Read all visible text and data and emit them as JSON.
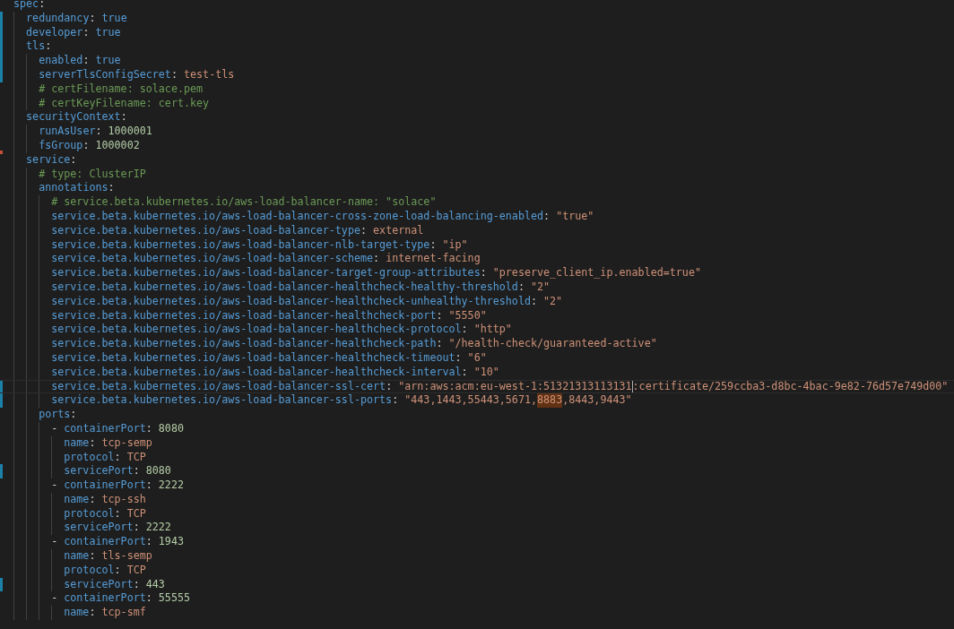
{
  "editor": {
    "lines": [
      {
        "tokens": [
          {
            "kind": "key",
            "text": "spec"
          },
          {
            "kind": "colon",
            "text": ":"
          }
        ],
        "children": [
          {
            "modified": true,
            "tokens": [
              {
                "kind": "key",
                "text": "redundancy"
              },
              {
                "kind": "colon",
                "text": ":"
              },
              {
                "kind": "bool",
                "text": "true"
              }
            ]
          },
          {
            "modified": true,
            "tokens": [
              {
                "kind": "key",
                "text": "developer"
              },
              {
                "kind": "colon",
                "text": ":"
              },
              {
                "kind": "bool",
                "text": "true"
              }
            ]
          },
          {
            "modified": true,
            "tokens": [
              {
                "kind": "key",
                "text": "tls"
              },
              {
                "kind": "colon",
                "text": ":"
              }
            ],
            "children": [
              {
                "modified": true,
                "tokens": [
                  {
                    "kind": "key",
                    "text": "enabled"
                  },
                  {
                    "kind": "colon",
                    "text": ":"
                  },
                  {
                    "kind": "bool",
                    "text": "true"
                  }
                ]
              },
              {
                "modified": true,
                "tokens": [
                  {
                    "kind": "key",
                    "text": "serverTlsConfigSecret"
                  },
                  {
                    "kind": "colon",
                    "text": ":"
                  },
                  {
                    "kind": "string",
                    "text": "test-tls"
                  }
                ]
              },
              {
                "tokens": [
                  {
                    "kind": "comment",
                    "text": "# certFilename: solace.pem"
                  }
                ]
              },
              {
                "tokens": [
                  {
                    "kind": "comment",
                    "text": "# certKeyFilename: cert.key"
                  }
                ]
              }
            ]
          },
          {
            "tokens": [
              {
                "kind": "key",
                "text": "securityContext"
              },
              {
                "kind": "colon",
                "text": ":"
              }
            ],
            "children": [
              {
                "tokens": [
                  {
                    "kind": "key",
                    "text": "runAsUser"
                  },
                  {
                    "kind": "colon",
                    "text": ":"
                  },
                  {
                    "kind": "number",
                    "text": "1000001"
                  }
                ]
              },
              {
                "tokens": [
                  {
                    "kind": "key",
                    "text": "fsGroup"
                  },
                  {
                    "kind": "colon",
                    "text": ":"
                  },
                  {
                    "kind": "number",
                    "text": "1000002"
                  }
                ]
              }
            ]
          },
          {
            "deleted_above": true,
            "tokens": [
              {
                "kind": "key",
                "text": "service"
              },
              {
                "kind": "colon",
                "text": ":"
              }
            ],
            "children": [
              {
                "tokens": [
                  {
                    "kind": "comment",
                    "text": "# type: ClusterIP"
                  }
                ]
              },
              {
                "tokens": [
                  {
                    "kind": "key",
                    "text": "annotations"
                  },
                  {
                    "kind": "colon",
                    "text": ":"
                  }
                ],
                "children": [
                  {
                    "tokens": [
                      {
                        "kind": "comment",
                        "text": "# service.beta.kubernetes.io/aws-load-balancer-name: \"solace\""
                      }
                    ]
                  },
                  {
                    "tokens": [
                      {
                        "kind": "key",
                        "text": "service.beta.kubernetes.io/aws-load-balancer-cross-zone-load-balancing-enabled"
                      },
                      {
                        "kind": "colon",
                        "text": ":"
                      },
                      {
                        "kind": "string",
                        "text": "\"true\""
                      }
                    ]
                  },
                  {
                    "tokens": [
                      {
                        "kind": "key",
                        "text": "service.beta.kubernetes.io/aws-load-balancer-type"
                      },
                      {
                        "kind": "colon",
                        "text": ":"
                      },
                      {
                        "kind": "string",
                        "text": "external"
                      }
                    ]
                  },
                  {
                    "tokens": [
                      {
                        "kind": "key",
                        "text": "service.beta.kubernetes.io/aws-load-balancer-nlb-target-type"
                      },
                      {
                        "kind": "colon",
                        "text": ":"
                      },
                      {
                        "kind": "string",
                        "text": "\"ip\""
                      }
                    ]
                  },
                  {
                    "tokens": [
                      {
                        "kind": "key",
                        "text": "service.beta.kubernetes.io/aws-load-balancer-scheme"
                      },
                      {
                        "kind": "colon",
                        "text": ":"
                      },
                      {
                        "kind": "string",
                        "text": "internet-facing"
                      }
                    ]
                  },
                  {
                    "tokens": [
                      {
                        "kind": "key",
                        "text": "service.beta.kubernetes.io/aws-load-balancer-target-group-attributes"
                      },
                      {
                        "kind": "colon",
                        "text": ":"
                      },
                      {
                        "kind": "string",
                        "text": "\"preserve_client_ip.enabled=true\""
                      }
                    ]
                  },
                  {
                    "tokens": [
                      {
                        "kind": "key",
                        "text": "service.beta.kubernetes.io/aws-load-balancer-healthcheck-healthy-threshold"
                      },
                      {
                        "kind": "colon",
                        "text": ":"
                      },
                      {
                        "kind": "string",
                        "text": "\"2\""
                      }
                    ]
                  },
                  {
                    "tokens": [
                      {
                        "kind": "key",
                        "text": "service.beta.kubernetes.io/aws-load-balancer-healthcheck-unhealthy-threshold"
                      },
                      {
                        "kind": "colon",
                        "text": ":"
                      },
                      {
                        "kind": "string",
                        "text": "\"2\""
                      }
                    ]
                  },
                  {
                    "tokens": [
                      {
                        "kind": "key",
                        "text": "service.beta.kubernetes.io/aws-load-balancer-healthcheck-port"
                      },
                      {
                        "kind": "colon",
                        "text": ":"
                      },
                      {
                        "kind": "string",
                        "text": "\"5550\""
                      }
                    ]
                  },
                  {
                    "tokens": [
                      {
                        "kind": "key",
                        "text": "service.beta.kubernetes.io/aws-load-balancer-healthcheck-protocol"
                      },
                      {
                        "kind": "colon",
                        "text": ":"
                      },
                      {
                        "kind": "string",
                        "text": "\"http\""
                      }
                    ]
                  },
                  {
                    "tokens": [
                      {
                        "kind": "key",
                        "text": "service.beta.kubernetes.io/aws-load-balancer-healthcheck-path"
                      },
                      {
                        "kind": "colon",
                        "text": ":"
                      },
                      {
                        "kind": "string",
                        "text": "\"/health-check/guaranteed-active\""
                      }
                    ]
                  },
                  {
                    "tokens": [
                      {
                        "kind": "key",
                        "text": "service.beta.kubernetes.io/aws-load-balancer-healthcheck-timeout"
                      },
                      {
                        "kind": "colon",
                        "text": ":"
                      },
                      {
                        "kind": "string",
                        "text": "\"6\""
                      }
                    ]
                  },
                  {
                    "tokens": [
                      {
                        "kind": "key",
                        "text": "service.beta.kubernetes.io/aws-load-balancer-healthcheck-interval"
                      },
                      {
                        "kind": "colon",
                        "text": ":"
                      },
                      {
                        "kind": "string",
                        "text": "\"10\""
                      }
                    ]
                  },
                  {
                    "modified": true,
                    "current": true,
                    "tokens": [
                      {
                        "kind": "key",
                        "text": "service.beta.kubernetes.io/aws-load-balancer-ssl-cert"
                      },
                      {
                        "kind": "colon",
                        "text": ":"
                      },
                      {
                        "kind": "string",
                        "text": "\"arn:aws:acm:eu-west-1:51321313113131"
                      },
                      {
                        "kind": "cursor"
                      },
                      {
                        "kind": "string",
                        "text": ":certificate/259ccba3-d8bc-4bac-9e82-76d57e749d00\""
                      }
                    ]
                  },
                  {
                    "modified": true,
                    "tokens": [
                      {
                        "kind": "key",
                        "text": "service.beta.kubernetes.io/aws-load-balancer-ssl-ports"
                      },
                      {
                        "kind": "colon",
                        "text": ":"
                      },
                      {
                        "kind": "string",
                        "text": "\"443,1443,55443,5671,",
                        "highlighted": false
                      },
                      {
                        "kind": "string",
                        "text": "8883",
                        "highlighted": true
                      },
                      {
                        "kind": "string",
                        "text": ",8443,9443\"",
                        "highlighted": false
                      }
                    ]
                  }
                ]
              },
              {
                "tokens": [
                  {
                    "kind": "key",
                    "text": "ports"
                  },
                  {
                    "kind": "colon",
                    "text": ":"
                  }
                ],
                "children": [
                  {
                    "tokens": [
                      {
                        "kind": "dash",
                        "text": "-"
                      },
                      {
                        "kind": "key",
                        "text": "containerPort"
                      },
                      {
                        "kind": "colon",
                        "text": ":"
                      },
                      {
                        "kind": "number",
                        "text": "8080"
                      }
                    ],
                    "children": [
                      {
                        "tokens": [
                          {
                            "kind": "key",
                            "text": "name"
                          },
                          {
                            "kind": "colon",
                            "text": ":"
                          },
                          {
                            "kind": "string",
                            "text": "tcp-semp"
                          }
                        ]
                      },
                      {
                        "tokens": [
                          {
                            "kind": "key",
                            "text": "protocol"
                          },
                          {
                            "kind": "colon",
                            "text": ":"
                          },
                          {
                            "kind": "string",
                            "text": "TCP"
                          }
                        ]
                      },
                      {
                        "modified": true,
                        "tokens": [
                          {
                            "kind": "key",
                            "text": "servicePort"
                          },
                          {
                            "kind": "colon",
                            "text": ":"
                          },
                          {
                            "kind": "number",
                            "text": "8080"
                          }
                        ]
                      }
                    ]
                  },
                  {
                    "tokens": [
                      {
                        "kind": "dash",
                        "text": "-"
                      },
                      {
                        "kind": "key",
                        "text": "containerPort"
                      },
                      {
                        "kind": "colon",
                        "text": ":"
                      },
                      {
                        "kind": "number",
                        "text": "2222"
                      }
                    ],
                    "children": [
                      {
                        "tokens": [
                          {
                            "kind": "key",
                            "text": "name"
                          },
                          {
                            "kind": "colon",
                            "text": ":"
                          },
                          {
                            "kind": "string",
                            "text": "tcp-ssh"
                          }
                        ]
                      },
                      {
                        "tokens": [
                          {
                            "kind": "key",
                            "text": "protocol"
                          },
                          {
                            "kind": "colon",
                            "text": ":"
                          },
                          {
                            "kind": "string",
                            "text": "TCP"
                          }
                        ]
                      },
                      {
                        "tokens": [
                          {
                            "kind": "key",
                            "text": "servicePort"
                          },
                          {
                            "kind": "colon",
                            "text": ":"
                          },
                          {
                            "kind": "number",
                            "text": "2222"
                          }
                        ]
                      }
                    ]
                  },
                  {
                    "tokens": [
                      {
                        "kind": "dash",
                        "text": "-"
                      },
                      {
                        "kind": "key",
                        "text": "containerPort"
                      },
                      {
                        "kind": "colon",
                        "text": ":"
                      },
                      {
                        "kind": "number",
                        "text": "1943"
                      }
                    ],
                    "children": [
                      {
                        "tokens": [
                          {
                            "kind": "key",
                            "text": "name"
                          },
                          {
                            "kind": "colon",
                            "text": ":"
                          },
                          {
                            "kind": "string",
                            "text": "tls-semp"
                          }
                        ]
                      },
                      {
                        "tokens": [
                          {
                            "kind": "key",
                            "text": "protocol"
                          },
                          {
                            "kind": "colon",
                            "text": ":"
                          },
                          {
                            "kind": "string",
                            "text": "TCP"
                          }
                        ]
                      },
                      {
                        "modified": true,
                        "tokens": [
                          {
                            "kind": "key",
                            "text": "servicePort"
                          },
                          {
                            "kind": "colon",
                            "text": ":"
                          },
                          {
                            "kind": "number",
                            "text": "443"
                          }
                        ]
                      }
                    ]
                  },
                  {
                    "tokens": [
                      {
                        "kind": "dash",
                        "text": "-"
                      },
                      {
                        "kind": "key",
                        "text": "containerPort"
                      },
                      {
                        "kind": "colon",
                        "text": ":"
                      },
                      {
                        "kind": "number",
                        "text": "55555"
                      }
                    ],
                    "children": [
                      {
                        "tokens": [
                          {
                            "kind": "key",
                            "text": "name"
                          },
                          {
                            "kind": "colon",
                            "text": ":"
                          },
                          {
                            "kind": "string",
                            "text": "tcp-smf"
                          }
                        ]
                      }
                    ]
                  }
                ]
              }
            ]
          }
        ]
      }
    ]
  }
}
